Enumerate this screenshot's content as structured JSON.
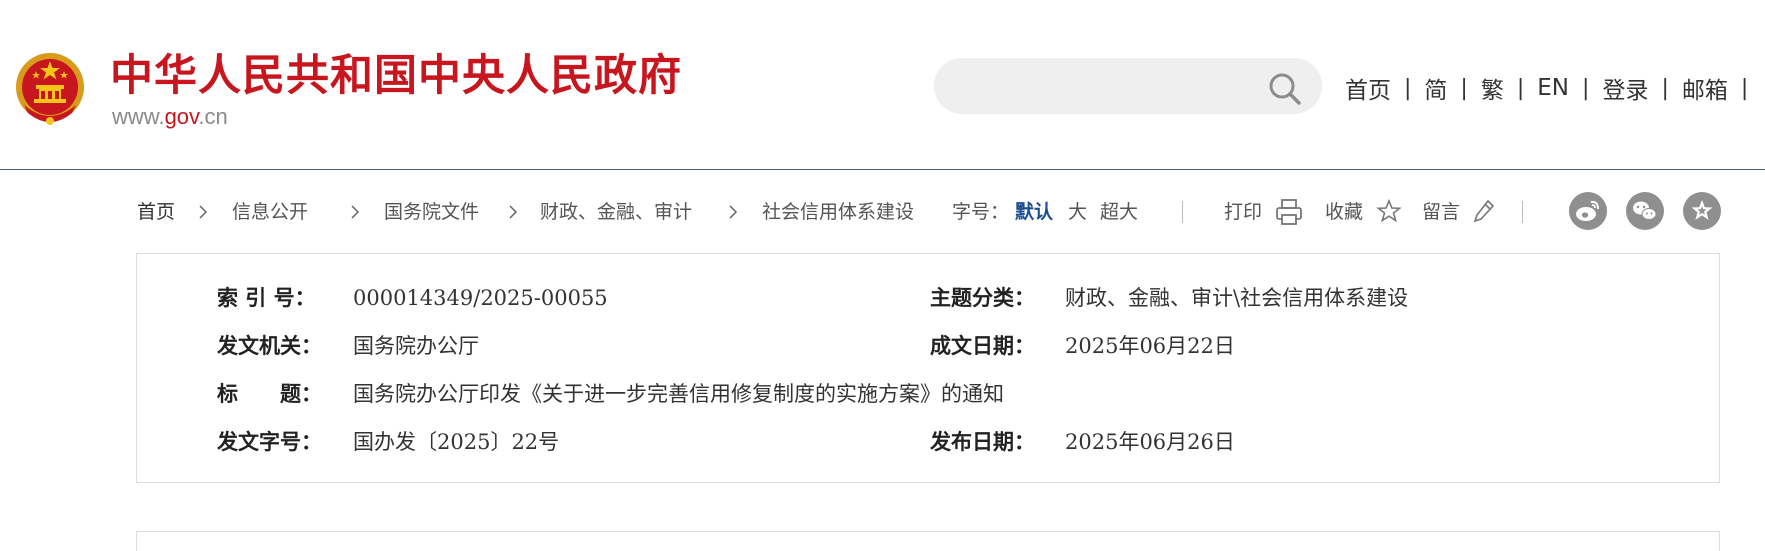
{
  "header": {
    "site_title": "中华人民共和国中央人民政府",
    "site_url_prefix": "www.",
    "site_url_highlight": "gov",
    "site_url_suffix": ".cn",
    "search": {
      "placeholder": "",
      "value": ""
    },
    "nav": [
      "首页",
      "简",
      "繁",
      "EN",
      "登录",
      "邮箱"
    ],
    "nav_separator": "|"
  },
  "breadcrumb": [
    "首页",
    "信息公开",
    "国务院文件",
    "财政、金融、审计",
    "社会信用体系建设"
  ],
  "font_size": {
    "label": "字号：",
    "default": "默认",
    "large": "大",
    "xlarge": "超大"
  },
  "tools": {
    "print": "打印",
    "favorite": "收藏",
    "comment": "留言"
  },
  "share": [
    "weibo-icon",
    "wechat-icon",
    "favorite-star-icon"
  ],
  "info": {
    "index_label": "索 引 号：",
    "index_value": "000014349/2025-00055",
    "subject_label": "主题分类：",
    "subject_value": "财政、金融、审计\\社会信用体系建设",
    "issuer_label": "发文机关：",
    "issuer_value": "国务院办公厅",
    "written_date_label": "成文日期：",
    "written_date_value": "2025年06月22日",
    "title_label": "标　　题：",
    "title_value": "国务院办公厅印发《关于进一步完善信用修复制度的实施方案》的通知",
    "doc_number_label": "发文字号：",
    "doc_number_value": "国办发〔2025〕22号",
    "publish_date_label": "发布日期：",
    "publish_date_value": "2025年06月26日"
  },
  "colors": {
    "brand_red": "#c8161e",
    "accent_blue": "#1b4f8f",
    "share_grey": "#8f8f8f"
  }
}
